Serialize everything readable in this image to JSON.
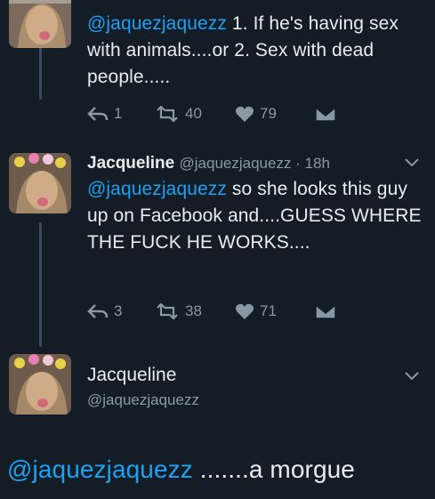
{
  "colors": {
    "background": "#141d26",
    "mention": "#1da1f2",
    "muted": "#8899a6",
    "text": "#e8ecef"
  },
  "tweets": [
    {
      "mention": "@jaquezjaquezz",
      "text": " 1. If he's having sex with animals....or 2. Sex with dead people.....",
      "replies": "1",
      "retweets": "40",
      "likes": "79"
    },
    {
      "name": "Jacqueline",
      "meta": "@jaquezjaquezz · 18h",
      "mention": "@jaquezjaquezz",
      "text": " so she looks this guy up on Facebook and....GUESS WHERE THE FUCK HE WORKS....",
      "replies": "3",
      "retweets": "38",
      "likes": "71"
    },
    {
      "name": "Jacqueline",
      "handle": "@jaquezjaquezz",
      "mention": "@jaquezjaquezz",
      "text": " .......a morgue"
    }
  ],
  "icons": [
    "reply-icon",
    "retweet-icon",
    "like-icon",
    "dm-icon",
    "chevron-down-icon"
  ]
}
